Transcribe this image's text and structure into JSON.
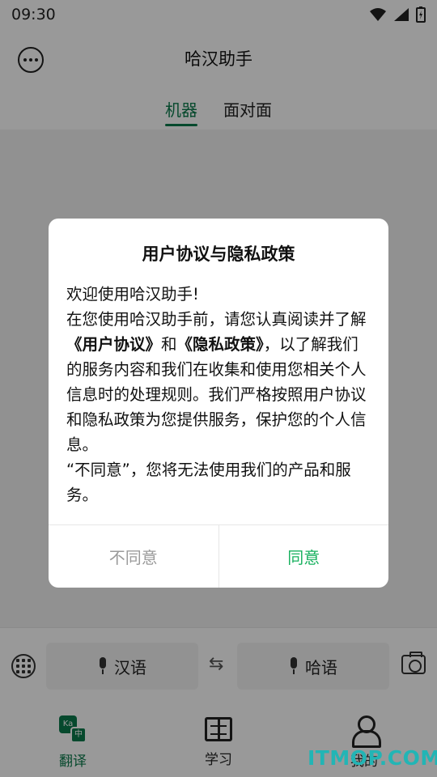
{
  "status_bar": {
    "time": "09:30"
  },
  "header": {
    "title": "哈汉助手"
  },
  "tabs": [
    {
      "label": "机器",
      "active": true
    },
    {
      "label": "面对面",
      "active": false
    }
  ],
  "input_bar": {
    "source_lang": "汉语",
    "target_lang": "哈语"
  },
  "bottom_nav": [
    {
      "label": "翻译",
      "active": true
    },
    {
      "label": "学习",
      "active": false
    },
    {
      "label": "我的",
      "active": false
    }
  ],
  "translate_icon": {
    "top_text": "Ka",
    "bottom_text": "中"
  },
  "dialog": {
    "title": "用户协议与隐私政策",
    "greeting": "欢迎使用哈汉助手!",
    "p1_a": "在您使用哈汉助手前，请您认真阅读并了解",
    "link_user_agreement": "《用户协议》",
    "p1_and": "和",
    "link_privacy_policy": "《隐私政策》",
    "p1_b": "，以了解我们的服务内容和我们在收集和使用您相关个人信息时的处理规则。我们严格按照用户协议和隐私政策为您提供服务，保护您的个人信息。",
    "p2": "“不同意”，您将无法使用我们的产品和服务。",
    "disagree_label": "不同意",
    "agree_label": "同意"
  },
  "watermark": "ITMOP.COM",
  "colors": {
    "accent": "#0b7a4b",
    "agree": "#18b15f",
    "disagree": "#9a9a9a"
  }
}
